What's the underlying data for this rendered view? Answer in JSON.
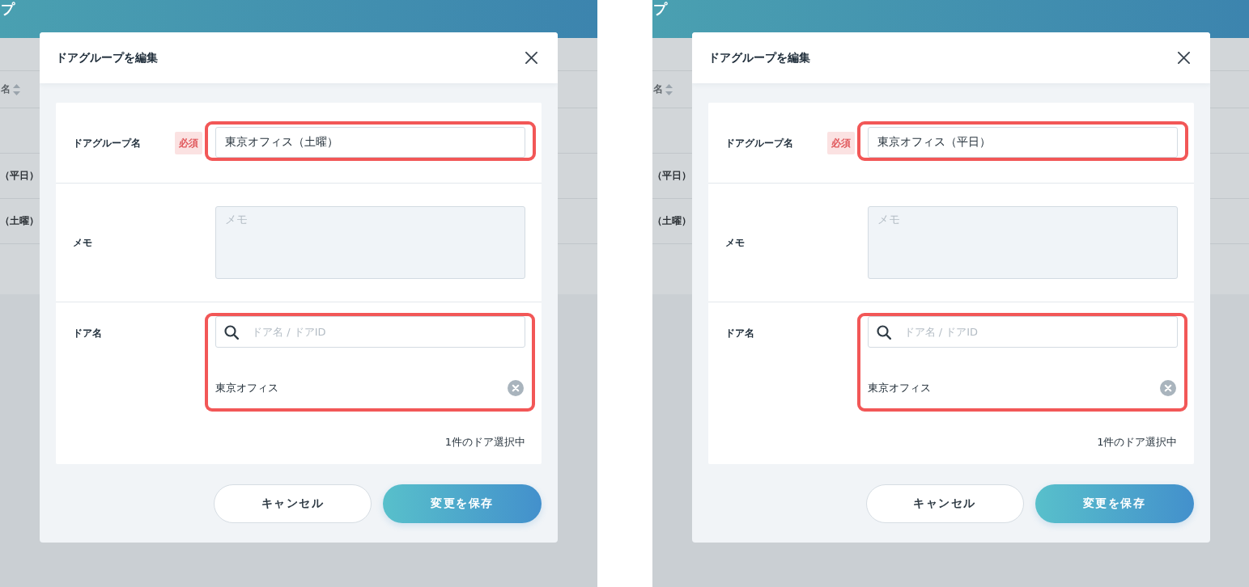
{
  "panels": [
    {
      "page": {
        "title": "プ",
        "table": {
          "columns": [
            "名"
          ],
          "rows": [
            "（平日）",
            "（土曜）"
          ]
        }
      },
      "dialog": {
        "title": "ドアグループを編集",
        "fields": [
          {
            "kind": "text",
            "label": "ドアグループ名",
            "badge": "必須",
            "value": "東京オフィス（土曜）",
            "highlighted": true
          },
          {
            "kind": "textarea",
            "label": "メモ",
            "placeholder": "メモ"
          },
          {
            "kind": "door_picker",
            "label": "ドア名",
            "placeholder": "ドア名 / ドアID",
            "selected_doors": [
              "東京オフィス"
            ],
            "count_text": "1件のドア選択中",
            "highlighted": true
          }
        ],
        "buttons": [
          {
            "kind": "secondary",
            "label": "キャンセル"
          },
          {
            "kind": "primary",
            "label": "変更を保存"
          }
        ]
      }
    },
    {
      "page": {
        "title": "プ",
        "table": {
          "columns": [
            "名"
          ],
          "rows": [
            "（平日）",
            "（土曜）"
          ]
        }
      },
      "dialog": {
        "title": "ドアグループを編集",
        "fields": [
          {
            "kind": "text",
            "label": "ドアグループ名",
            "badge": "必須",
            "value": "東京オフィス（平日）",
            "highlighted": true
          },
          {
            "kind": "textarea",
            "label": "メモ",
            "placeholder": "メモ"
          },
          {
            "kind": "door_picker",
            "label": "ドア名",
            "placeholder": "ドア名 / ドアID",
            "selected_doors": [
              "東京オフィス"
            ],
            "count_text": "1件のドア選択中",
            "highlighted": true
          }
        ],
        "buttons": [
          {
            "kind": "secondary",
            "label": "キャンセル"
          },
          {
            "kind": "primary",
            "label": "変更を保存"
          }
        ]
      }
    }
  ]
}
